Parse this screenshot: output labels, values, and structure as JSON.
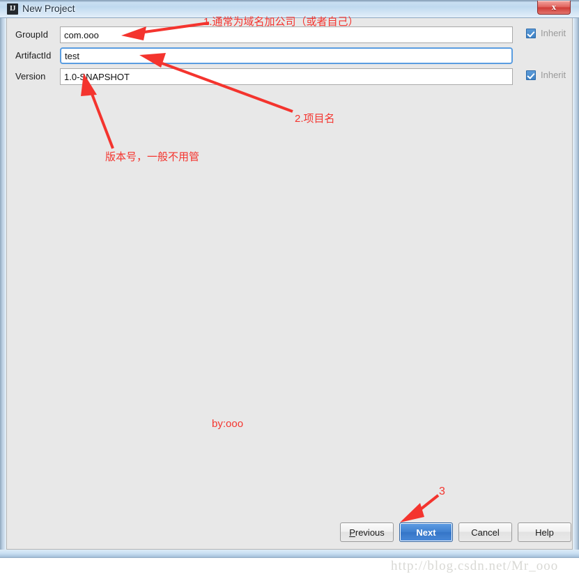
{
  "window": {
    "title": "New Project",
    "app_icon": "IJ",
    "close_label": "x",
    "close_icon": "close-icon"
  },
  "form": {
    "rows": [
      {
        "label": "GroupId",
        "value": "com.ooo",
        "placeholder": "",
        "focused": false,
        "inherit": {
          "label": "Inherit",
          "checked": true,
          "visible": true
        }
      },
      {
        "label": "ArtifactId",
        "value": "test",
        "placeholder": "",
        "focused": true,
        "inherit": {
          "label": "",
          "checked": false,
          "visible": false
        }
      },
      {
        "label": "Version",
        "value": "1.0-SNAPSHOT",
        "placeholder": "",
        "focused": false,
        "inherit": {
          "label": "Inherit",
          "checked": true,
          "visible": true
        }
      }
    ]
  },
  "annotations": {
    "color": "#f4342e",
    "note_1": "1.通常为域名加公司（或者自己）",
    "note_2": "2.项目名",
    "note_3": "版本号，一般不用管",
    "note_next": "3",
    "signature": "by:ooo"
  },
  "watermark": {
    "text": "http://blog.csdn.net/Mr_ooo"
  },
  "buttons": {
    "previous": {
      "label": "Previous",
      "mnemonic": "P",
      "rest": "revious"
    },
    "next": {
      "label": "Next"
    },
    "cancel": {
      "label": "Cancel"
    },
    "help": {
      "label": "Help"
    }
  }
}
